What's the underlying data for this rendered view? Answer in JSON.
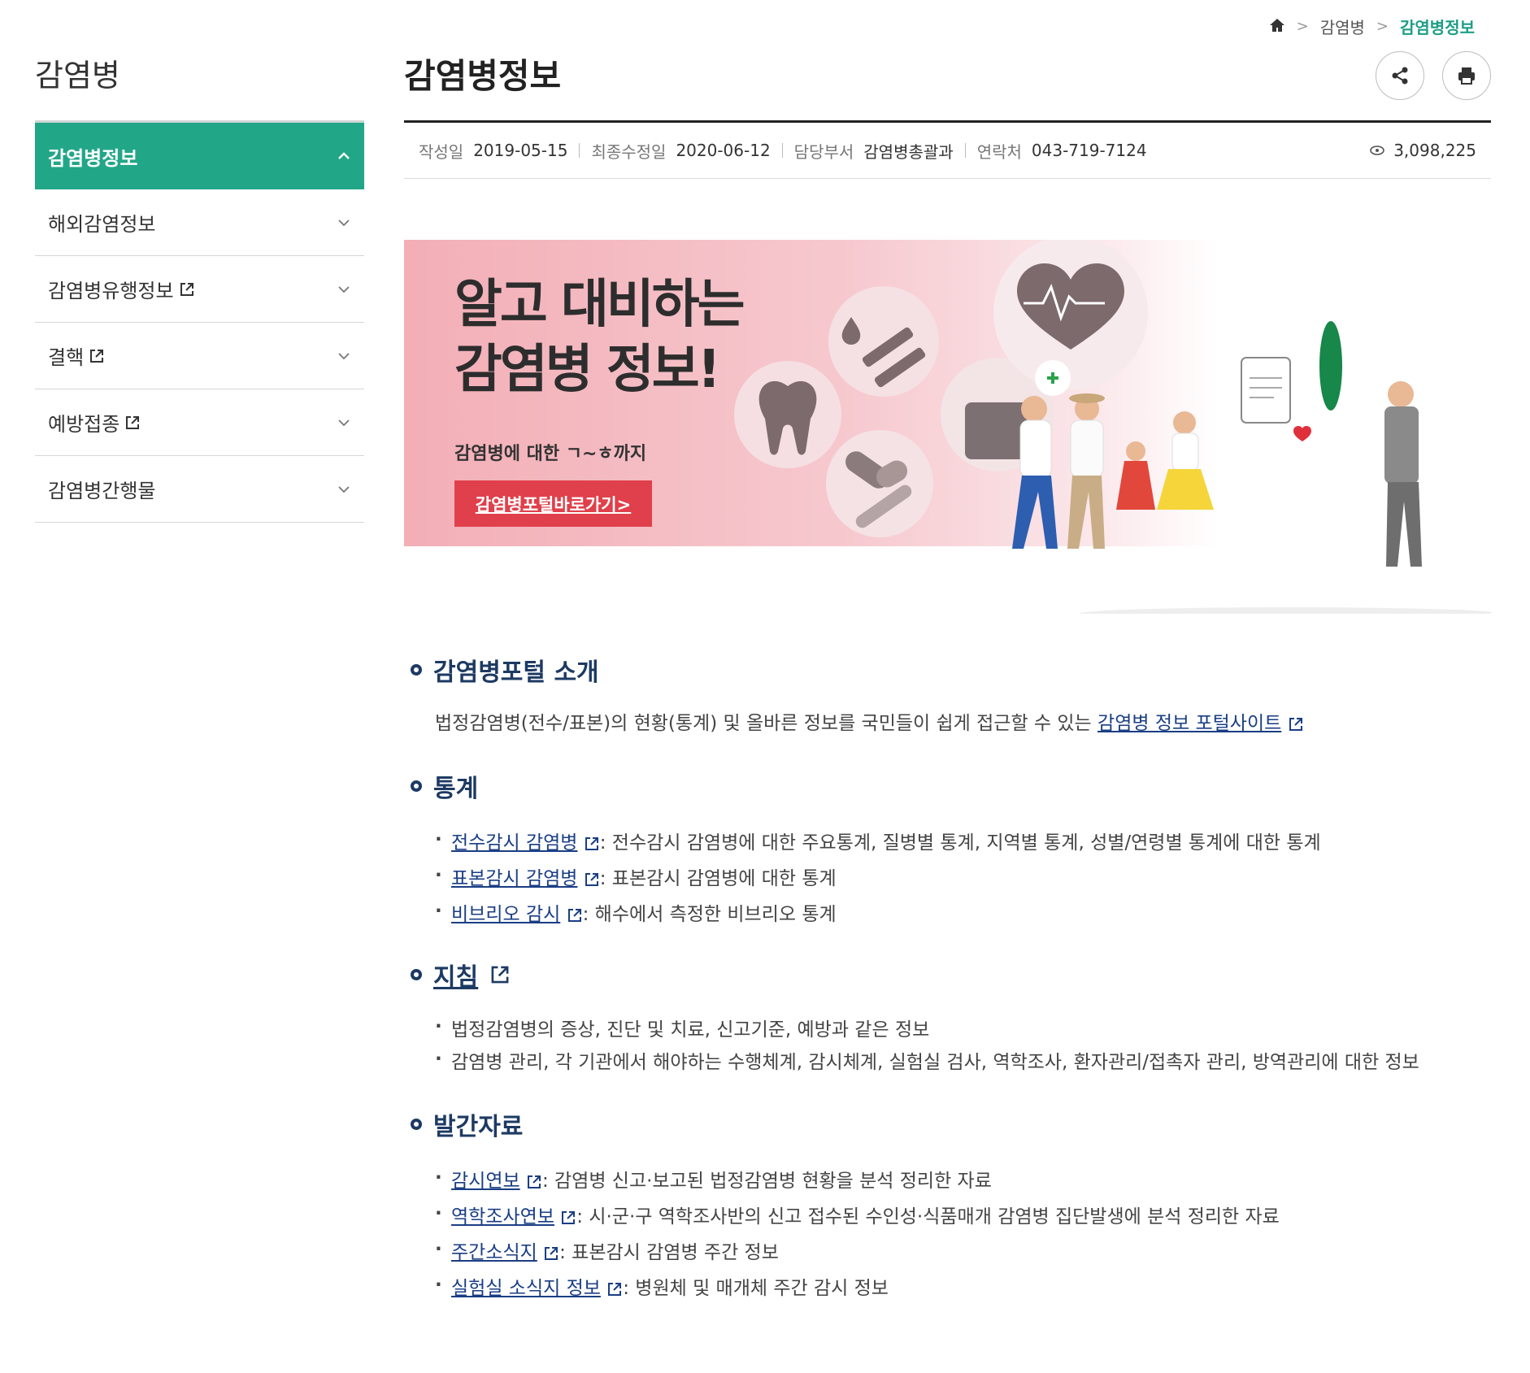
{
  "breadcrumb": {
    "home_icon": "home-icon",
    "level1": "감염병",
    "current": "감염병정보"
  },
  "sidebar": {
    "title": "감염병",
    "items": [
      {
        "label": "감염병정보",
        "external": false,
        "active": true
      },
      {
        "label": "해외감염정보",
        "external": false,
        "active": false
      },
      {
        "label": "감염병유행정보",
        "external": true,
        "active": false
      },
      {
        "label": "결핵",
        "external": true,
        "active": false
      },
      {
        "label": "예방접종",
        "external": true,
        "active": false
      },
      {
        "label": "감염병간행물",
        "external": false,
        "active": false
      }
    ]
  },
  "page": {
    "title": "감염병정보"
  },
  "meta": {
    "created_label": "작성일",
    "created": "2019-05-15",
    "modified_label": "최종수정일",
    "modified": "2020-06-12",
    "dept_label": "담당부서",
    "dept": "감염병총괄과",
    "contact_label": "연락처",
    "contact": "043-719-7124",
    "views": "3,098,225"
  },
  "banner": {
    "headline_1": "알고 대비하는",
    "headline_2": "감염병 정보!",
    "sub": "감염병에 대한 ㄱ~ㅎ까지",
    "button": "감염병포털바로가기>"
  },
  "sections": {
    "portal": {
      "title": "감염병포털 소개",
      "text": "법정감염병(전수/표본)의 현황(통계) 및 올바른 정보를 국민들이 쉽게 접근할 수 있는 ",
      "link": "감염병 정보 포털사이트"
    },
    "stats": {
      "title": "통계",
      "items": [
        {
          "link": "전수감시 감염병",
          "desc": ": 전수감시 감염병에 대한 주요통계, 질병별 통계, 지역별 통계, 성별/연령별 통계에 대한 통계"
        },
        {
          "link": "표본감시 감염병",
          "desc": ": 표본감시 감염병에 대한 통계"
        },
        {
          "link": "비브리오 감시",
          "desc": ": 해수에서 측정한 비브리오 통계"
        }
      ]
    },
    "guide": {
      "title": "지침",
      "items": [
        "법정감염병의 증상, 진단 및 치료, 신고기준, 예방과 같은 정보",
        "감염병 관리, 각 기관에서 해야하는 수행체계, 감시체계, 실험실 검사, 역학조사, 환자관리/접촉자 관리, 방역관리에 대한 정보"
      ]
    },
    "pubs": {
      "title": "발간자료",
      "items": [
        {
          "link": "감시연보",
          "desc": ": 감염병 신고·보고된 법정감염병 현황을 분석 정리한 자료"
        },
        {
          "link": "역학조사연보",
          "desc": ": 시·군·구 역학조사반의 신고 접수된 수인성·식품매개 감염병 집단발생에 분석 정리한 자료"
        },
        {
          "link": "주간소식지",
          "desc": ": 표본감시 감염병 주간 정보"
        },
        {
          "link": "실험실 소식지 정보",
          "desc": ": 병원체 및 매개체 주간 감시 정보"
        }
      ]
    }
  },
  "colors": {
    "accent": "#22a688",
    "navy": "#1d3a63",
    "banner_button": "#e0404b"
  }
}
